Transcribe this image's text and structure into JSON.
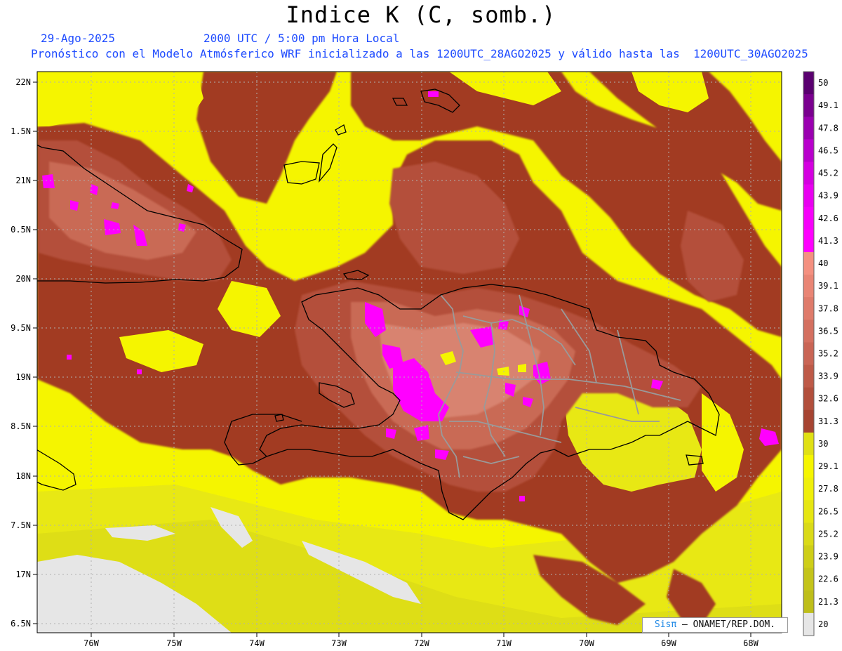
{
  "header": {
    "title": "Indice K (C, somb.)",
    "date": "29-Ago-2025",
    "time": "2000 UTC / 5:00 pm Hora Local",
    "forecast_info": "Pronóstico con el Modelo Atmósferico WRF inicializado a las 1200UTC_28AGO2025 y válido hasta las  1200UTC_30AGO2025"
  },
  "map": {
    "lat_labels": [
      "22N",
      "1.5N",
      "21N",
      "0.5N",
      "20N",
      "9.5N",
      "19N",
      "8.5N",
      "18N",
      "7.5N",
      "17N",
      "6.5N"
    ],
    "lon_labels": [
      "76W",
      "75W",
      "74W",
      "73W",
      "72W",
      "71W",
      "70W",
      "69W",
      "68W"
    ],
    "colors": {
      "background_low": "#e6e6e6",
      "yellow": "#f5f500",
      "yellow_dark": "#e6e612",
      "brown_dark": "#a23a22",
      "brown_mid": "#b4503a",
      "brown_light": "#c56a55",
      "salmon": "#d98a78",
      "magenta": "#ff00ff",
      "coastline": "#000000",
      "provinces": "#9a9a9a"
    }
  },
  "colorbar": {
    "labels": [
      "50",
      "49.1",
      "47.8",
      "46.5",
      "45.2",
      "43.9",
      "42.6",
      "41.3",
      "40",
      "39.1",
      "37.8",
      "36.5",
      "35.2",
      "33.9",
      "32.6",
      "31.3",
      "30",
      "29.1",
      "27.8",
      "26.5",
      "25.2",
      "23.9",
      "22.6",
      "21.3",
      "20"
    ],
    "colors": [
      "#5a0070",
      "#7a008f",
      "#9a00b0",
      "#b800cc",
      "#d400e0",
      "#e800f0",
      "#f600fa",
      "#ff00ff",
      "#f49080",
      "#e98575",
      "#df7b6b",
      "#d47060",
      "#c96555",
      "#be5a48",
      "#b24f3c",
      "#a64432",
      "#e0e014",
      "#f5f500",
      "#efef0a",
      "#e6e612",
      "#dada18",
      "#cece18",
      "#c4c41a",
      "#bebe1a",
      "#e6e6e6"
    ]
  },
  "credit": {
    "sis": "Sisπ",
    "org": "– ONAMET/REP.DOM."
  }
}
